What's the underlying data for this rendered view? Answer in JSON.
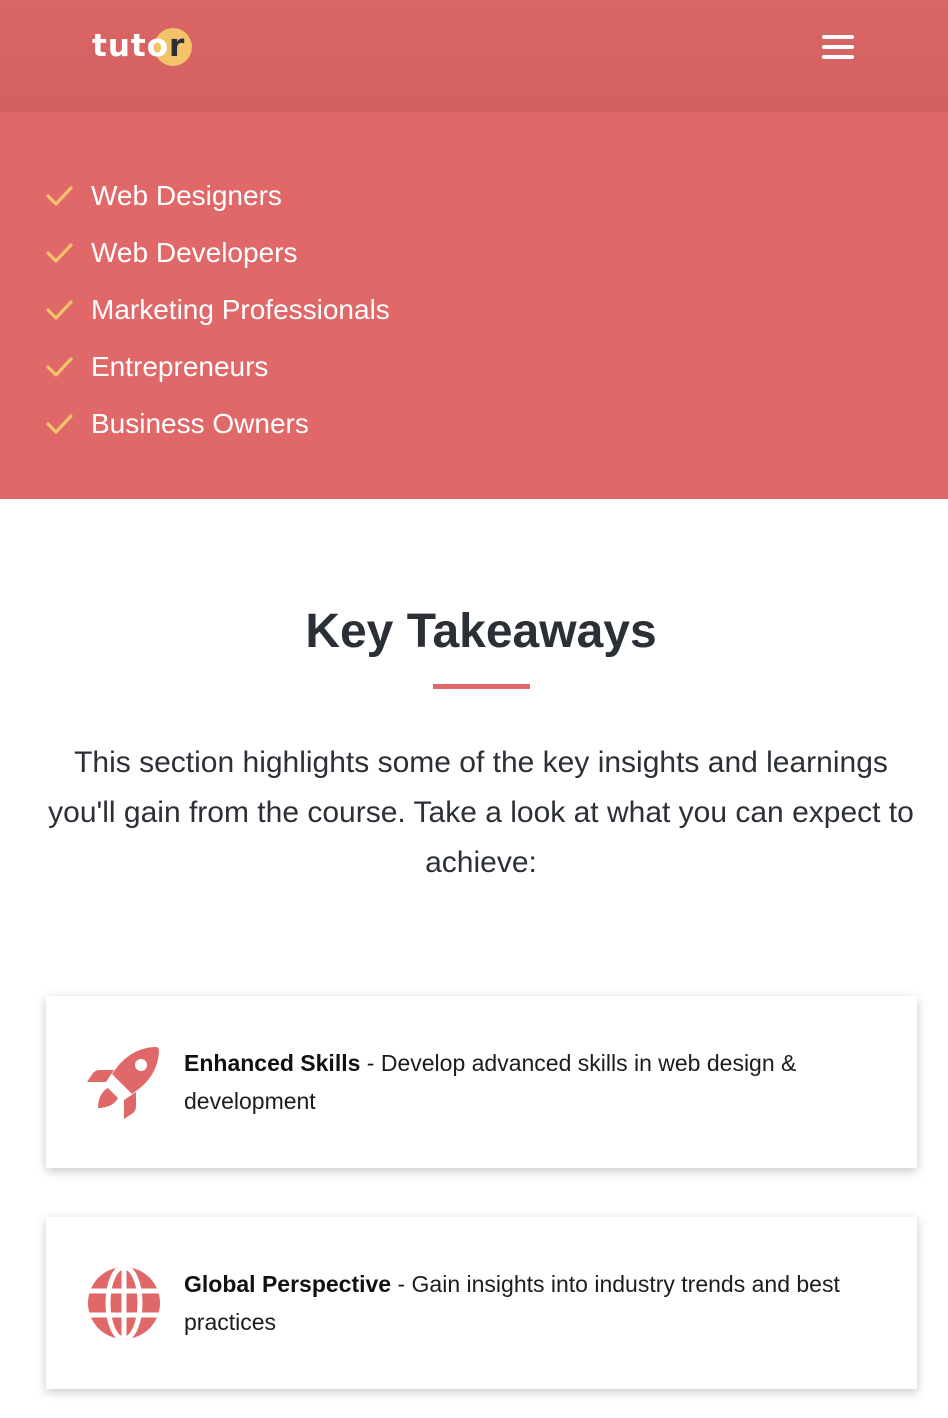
{
  "header": {
    "logo": {
      "text_main": "tuto",
      "text_last": "r",
      "accent_color": "#f2c36b"
    },
    "menu_icon": "hamburger-menu-icon"
  },
  "audience": {
    "background_color": "#e06868",
    "check_icon": "check-icon",
    "check_color": "#f2c36b",
    "items": [
      {
        "label": "Web Designers"
      },
      {
        "label": "Web Developers"
      },
      {
        "label": "Marketing Professionals"
      },
      {
        "label": "Entrepreneurs"
      },
      {
        "label": "Business Owners"
      }
    ]
  },
  "takeaways": {
    "title": "Key Takeaways",
    "intro": "This section highlights some of the key insights and learnings you'll gain from the course. Take a look at what you can expect to achieve:",
    "accent_color": "#e06868",
    "cards": [
      {
        "icon": "rocket-icon",
        "heading": "Enhanced Skills",
        "separator": " - ",
        "description": "Develop advanced skills in web design & development"
      },
      {
        "icon": "globe-icon",
        "heading": "Global Perspective",
        "separator": " - ",
        "description": "Gain insights into industry trends and best practices"
      }
    ]
  }
}
